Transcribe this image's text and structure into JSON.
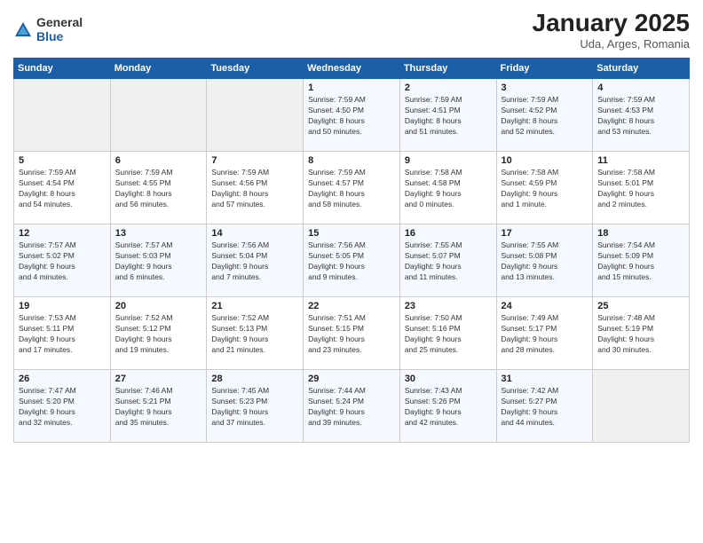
{
  "logo": {
    "general": "General",
    "blue": "Blue"
  },
  "title": "January 2025",
  "subtitle": "Uda, Arges, Romania",
  "weekdays": [
    "Sunday",
    "Monday",
    "Tuesday",
    "Wednesday",
    "Thursday",
    "Friday",
    "Saturday"
  ],
  "weeks": [
    [
      {
        "day": "",
        "info": ""
      },
      {
        "day": "",
        "info": ""
      },
      {
        "day": "",
        "info": ""
      },
      {
        "day": "1",
        "info": "Sunrise: 7:59 AM\nSunset: 4:50 PM\nDaylight: 8 hours\nand 50 minutes."
      },
      {
        "day": "2",
        "info": "Sunrise: 7:59 AM\nSunset: 4:51 PM\nDaylight: 8 hours\nand 51 minutes."
      },
      {
        "day": "3",
        "info": "Sunrise: 7:59 AM\nSunset: 4:52 PM\nDaylight: 8 hours\nand 52 minutes."
      },
      {
        "day": "4",
        "info": "Sunrise: 7:59 AM\nSunset: 4:53 PM\nDaylight: 8 hours\nand 53 minutes."
      }
    ],
    [
      {
        "day": "5",
        "info": "Sunrise: 7:59 AM\nSunset: 4:54 PM\nDaylight: 8 hours\nand 54 minutes."
      },
      {
        "day": "6",
        "info": "Sunrise: 7:59 AM\nSunset: 4:55 PM\nDaylight: 8 hours\nand 56 minutes."
      },
      {
        "day": "7",
        "info": "Sunrise: 7:59 AM\nSunset: 4:56 PM\nDaylight: 8 hours\nand 57 minutes."
      },
      {
        "day": "8",
        "info": "Sunrise: 7:59 AM\nSunset: 4:57 PM\nDaylight: 8 hours\nand 58 minutes."
      },
      {
        "day": "9",
        "info": "Sunrise: 7:58 AM\nSunset: 4:58 PM\nDaylight: 9 hours\nand 0 minutes."
      },
      {
        "day": "10",
        "info": "Sunrise: 7:58 AM\nSunset: 4:59 PM\nDaylight: 9 hours\nand 1 minute."
      },
      {
        "day": "11",
        "info": "Sunrise: 7:58 AM\nSunset: 5:01 PM\nDaylight: 9 hours\nand 2 minutes."
      }
    ],
    [
      {
        "day": "12",
        "info": "Sunrise: 7:57 AM\nSunset: 5:02 PM\nDaylight: 9 hours\nand 4 minutes."
      },
      {
        "day": "13",
        "info": "Sunrise: 7:57 AM\nSunset: 5:03 PM\nDaylight: 9 hours\nand 6 minutes."
      },
      {
        "day": "14",
        "info": "Sunrise: 7:56 AM\nSunset: 5:04 PM\nDaylight: 9 hours\nand 7 minutes."
      },
      {
        "day": "15",
        "info": "Sunrise: 7:56 AM\nSunset: 5:05 PM\nDaylight: 9 hours\nand 9 minutes."
      },
      {
        "day": "16",
        "info": "Sunrise: 7:55 AM\nSunset: 5:07 PM\nDaylight: 9 hours\nand 11 minutes."
      },
      {
        "day": "17",
        "info": "Sunrise: 7:55 AM\nSunset: 5:08 PM\nDaylight: 9 hours\nand 13 minutes."
      },
      {
        "day": "18",
        "info": "Sunrise: 7:54 AM\nSunset: 5:09 PM\nDaylight: 9 hours\nand 15 minutes."
      }
    ],
    [
      {
        "day": "19",
        "info": "Sunrise: 7:53 AM\nSunset: 5:11 PM\nDaylight: 9 hours\nand 17 minutes."
      },
      {
        "day": "20",
        "info": "Sunrise: 7:52 AM\nSunset: 5:12 PM\nDaylight: 9 hours\nand 19 minutes."
      },
      {
        "day": "21",
        "info": "Sunrise: 7:52 AM\nSunset: 5:13 PM\nDaylight: 9 hours\nand 21 minutes."
      },
      {
        "day": "22",
        "info": "Sunrise: 7:51 AM\nSunset: 5:15 PM\nDaylight: 9 hours\nand 23 minutes."
      },
      {
        "day": "23",
        "info": "Sunrise: 7:50 AM\nSunset: 5:16 PM\nDaylight: 9 hours\nand 25 minutes."
      },
      {
        "day": "24",
        "info": "Sunrise: 7:49 AM\nSunset: 5:17 PM\nDaylight: 9 hours\nand 28 minutes."
      },
      {
        "day": "25",
        "info": "Sunrise: 7:48 AM\nSunset: 5:19 PM\nDaylight: 9 hours\nand 30 minutes."
      }
    ],
    [
      {
        "day": "26",
        "info": "Sunrise: 7:47 AM\nSunset: 5:20 PM\nDaylight: 9 hours\nand 32 minutes."
      },
      {
        "day": "27",
        "info": "Sunrise: 7:46 AM\nSunset: 5:21 PM\nDaylight: 9 hours\nand 35 minutes."
      },
      {
        "day": "28",
        "info": "Sunrise: 7:45 AM\nSunset: 5:23 PM\nDaylight: 9 hours\nand 37 minutes."
      },
      {
        "day": "29",
        "info": "Sunrise: 7:44 AM\nSunset: 5:24 PM\nDaylight: 9 hours\nand 39 minutes."
      },
      {
        "day": "30",
        "info": "Sunrise: 7:43 AM\nSunset: 5:26 PM\nDaylight: 9 hours\nand 42 minutes."
      },
      {
        "day": "31",
        "info": "Sunrise: 7:42 AM\nSunset: 5:27 PM\nDaylight: 9 hours\nand 44 minutes."
      },
      {
        "day": "",
        "info": ""
      }
    ]
  ]
}
